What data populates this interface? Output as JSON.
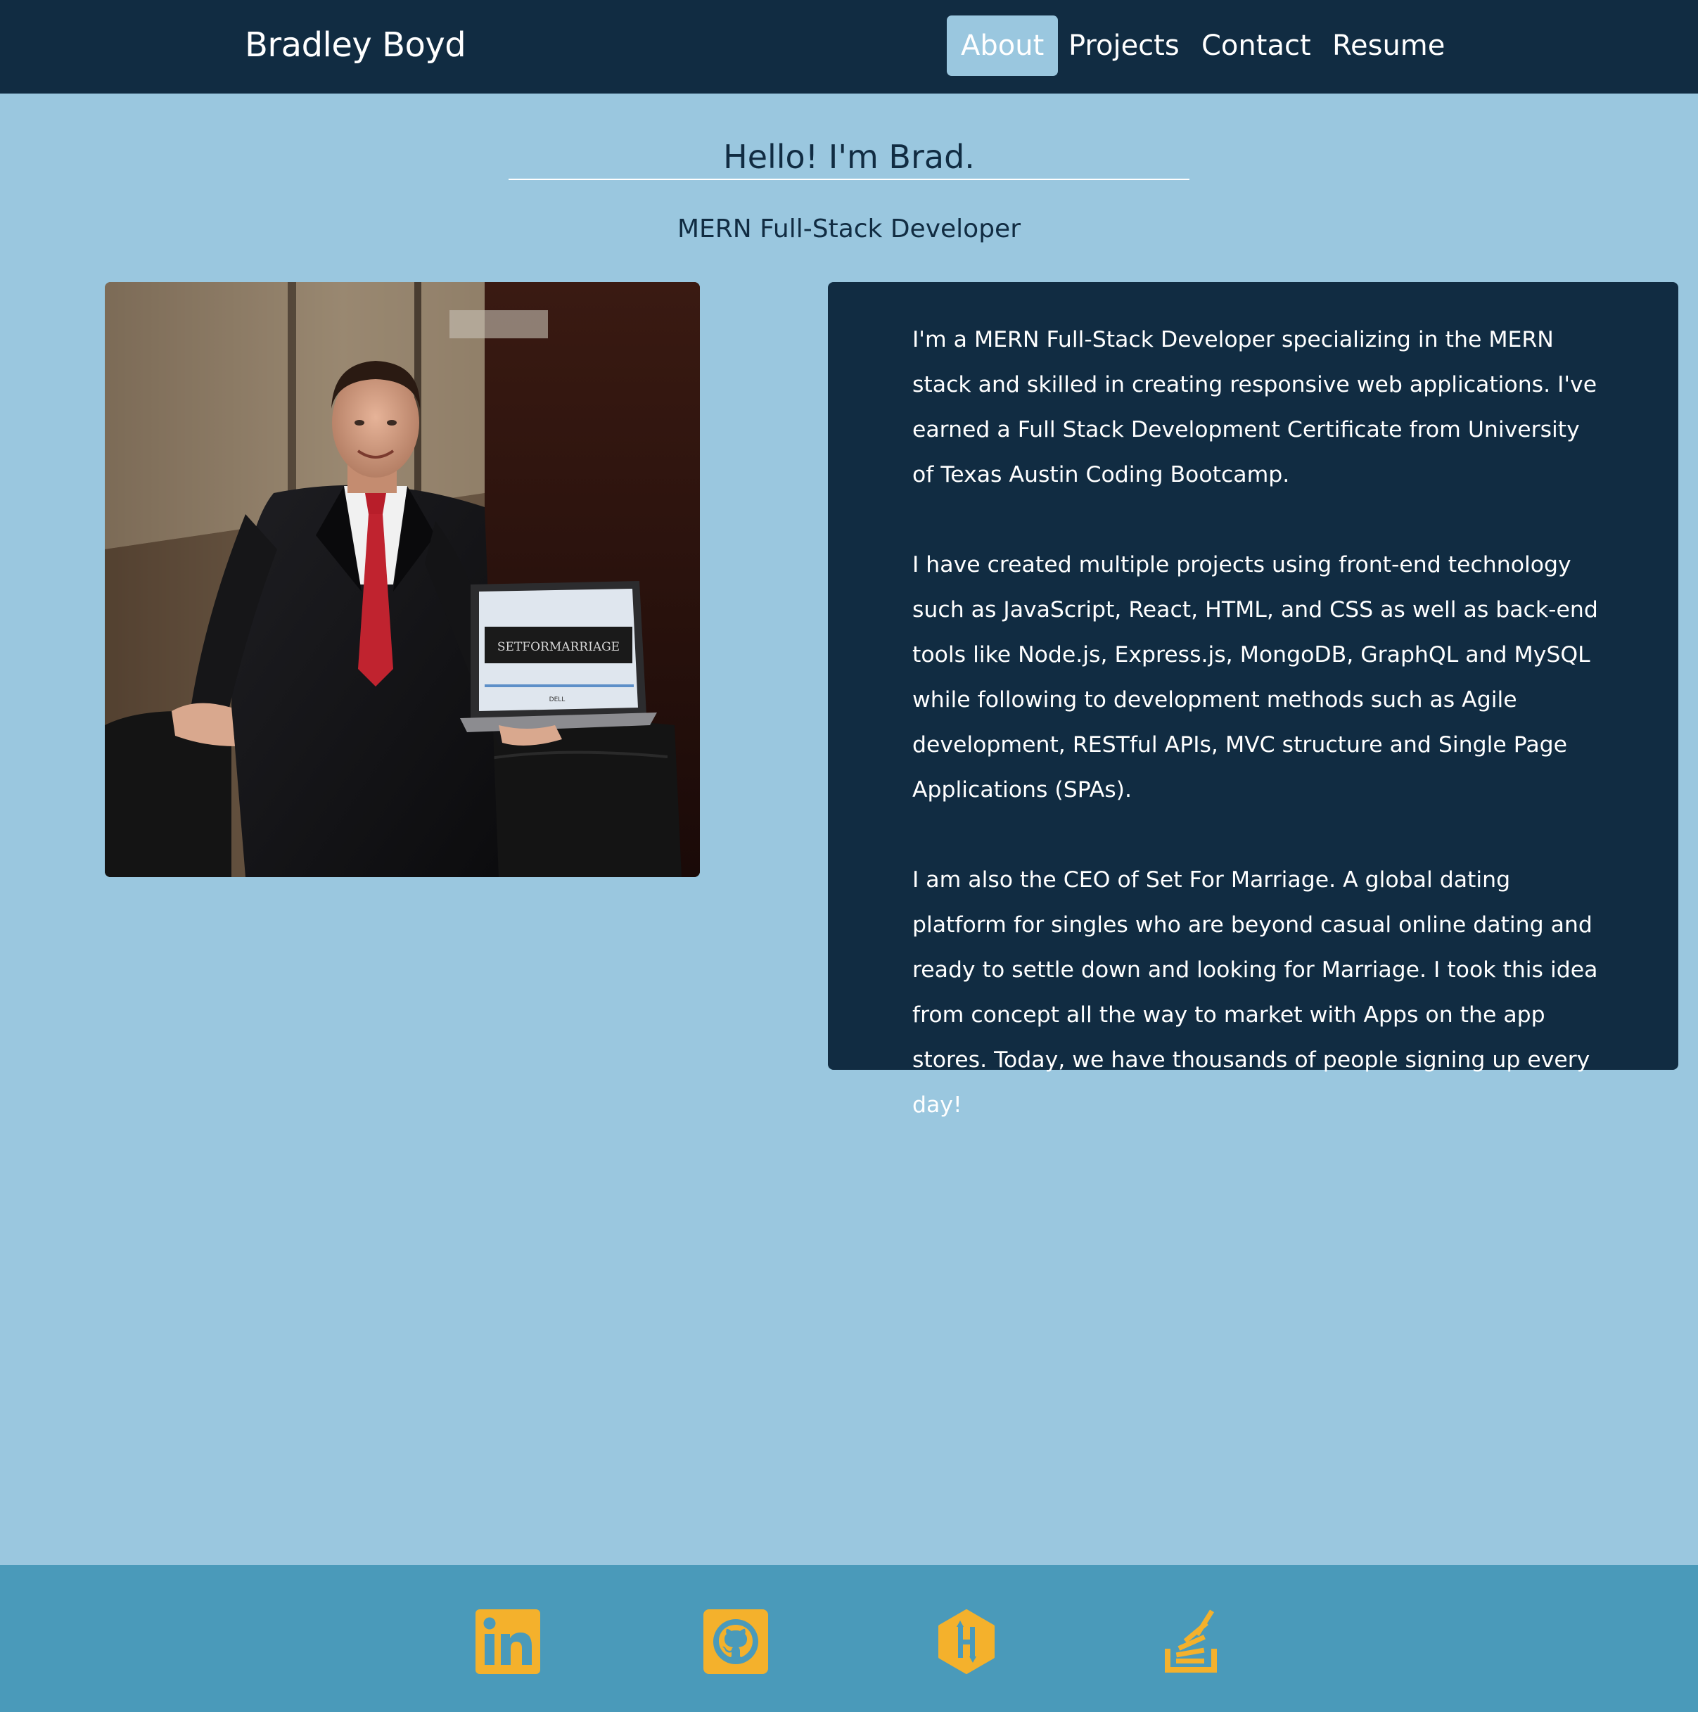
{
  "navbar": {
    "brand": "Bradley Boyd",
    "links": [
      {
        "label": "About",
        "active": true
      },
      {
        "label": "Projects",
        "active": false
      },
      {
        "label": "Contact",
        "active": false
      },
      {
        "label": "Resume",
        "active": false
      }
    ]
  },
  "hero": {
    "title": "Hello! I'm Brad.",
    "subtitle": "MERN Full-Stack Developer"
  },
  "photo": {
    "screen_logo": "SETFORMARRIAGE",
    "laptop_brand": "DELL"
  },
  "bio": {
    "paragraphs": [
      "I'm a MERN Full-Stack Developer specializing in the MERN stack and skilled in creating responsive web applications. I've earned a Full Stack Development Certificate from University of Texas Austin Coding Bootcamp.",
      "I have created multiple projects using front-end technology such as JavaScript, React, HTML, and CSS as well as back-end tools like Node.js, Express.js, MongoDB, GraphQL and MySQL while following to development methods such as Agile development, RESTful APIs, MVC structure and Single Page Applications (SPAs).",
      "I am also the CEO of Set For Marriage. A global dating platform for singles who are beyond casual online dating and ready to settle down and looking for Marriage. I took this idea from concept all the way to market with Apps on the app stores. Today, we have thousands of people signing up every day!"
    ]
  },
  "footer": {
    "social_icons": [
      "linkedin-icon",
      "github-icon",
      "hashnode-icon",
      "stackoverflow-icon"
    ],
    "icon_color": "#f4b12c"
  },
  "colors": {
    "navbar_bg": "#112c42",
    "page_bg": "#9ac7df",
    "footer_bg": "#4a9aba",
    "accent": "#f4b12c"
  }
}
